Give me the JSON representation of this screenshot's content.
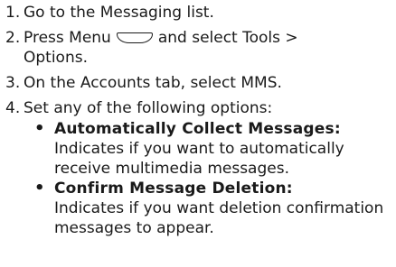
{
  "steps": [
    {
      "number": "1.",
      "text": "Go to the Messaging list."
    },
    {
      "number": "2.",
      "text_before": "Press Menu",
      "icon": "menu-key-icon",
      "text_after": "and select Tools >",
      "continuation": "Options."
    },
    {
      "number": "3.",
      "text": "On the Accounts tab, select MMS."
    },
    {
      "number": "4.",
      "text": "Set any of the following options:"
    }
  ],
  "options": [
    {
      "bullet": "•",
      "term": "Automatically Collect Messages:",
      "description": "Indicates if you want to automatically receive multimedia messages."
    },
    {
      "bullet": "•",
      "term": "Confirm Message Deletion:",
      "description": "Indicates if you want deletion confirmation messages to appear."
    }
  ]
}
